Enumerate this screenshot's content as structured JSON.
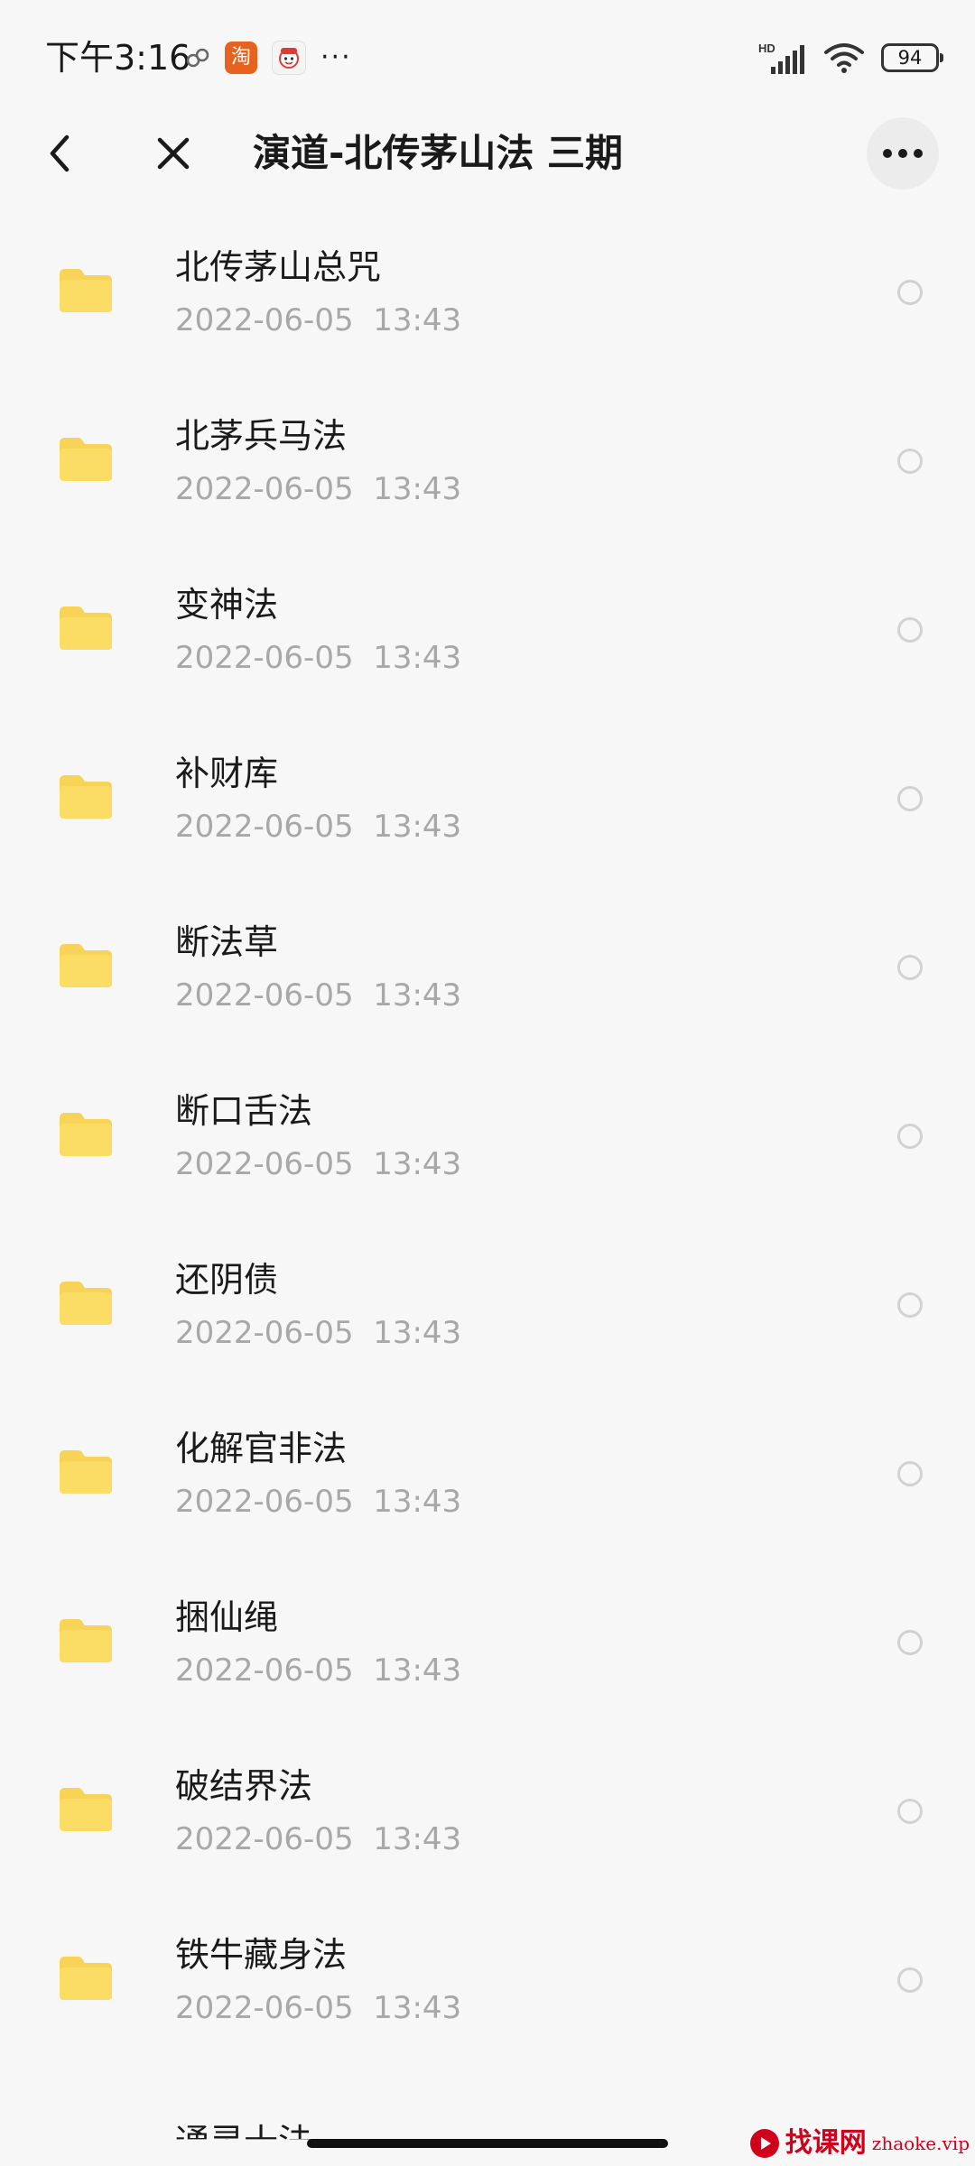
{
  "status_bar": {
    "time": "下午3:16",
    "battery": "94",
    "hd_label": "HD",
    "taobao_icon_label": "淘",
    "more_dots": "···"
  },
  "header": {
    "title": "演道-北传茅山法 三期"
  },
  "files": [
    {
      "name": "北传茅山总咒",
      "date": "2022-06-05  13:43"
    },
    {
      "name": "北茅兵马法",
      "date": "2022-06-05  13:43"
    },
    {
      "name": "变神法",
      "date": "2022-06-05  13:43"
    },
    {
      "name": "补财库",
      "date": "2022-06-05  13:43"
    },
    {
      "name": "断法草",
      "date": "2022-06-05  13:43"
    },
    {
      "name": "断口舌法",
      "date": "2022-06-05  13:43"
    },
    {
      "name": "还阴债",
      "date": "2022-06-05  13:43"
    },
    {
      "name": "化解官非法",
      "date": "2022-06-05  13:43"
    },
    {
      "name": "捆仙绳",
      "date": "2022-06-05  13:43"
    },
    {
      "name": "破结界法",
      "date": "2022-06-05  13:43"
    },
    {
      "name": "铁牛藏身法",
      "date": "2022-06-05  13:43"
    }
  ],
  "partial_file": {
    "name": "通灵十法"
  },
  "watermark": {
    "cn": "找课网",
    "en": "zhaoke.vip"
  },
  "colors": {
    "folder": "#f7d458",
    "date_text": "#a8a8a8",
    "background": "#f7f7f7",
    "watermark": "#d0021b"
  }
}
